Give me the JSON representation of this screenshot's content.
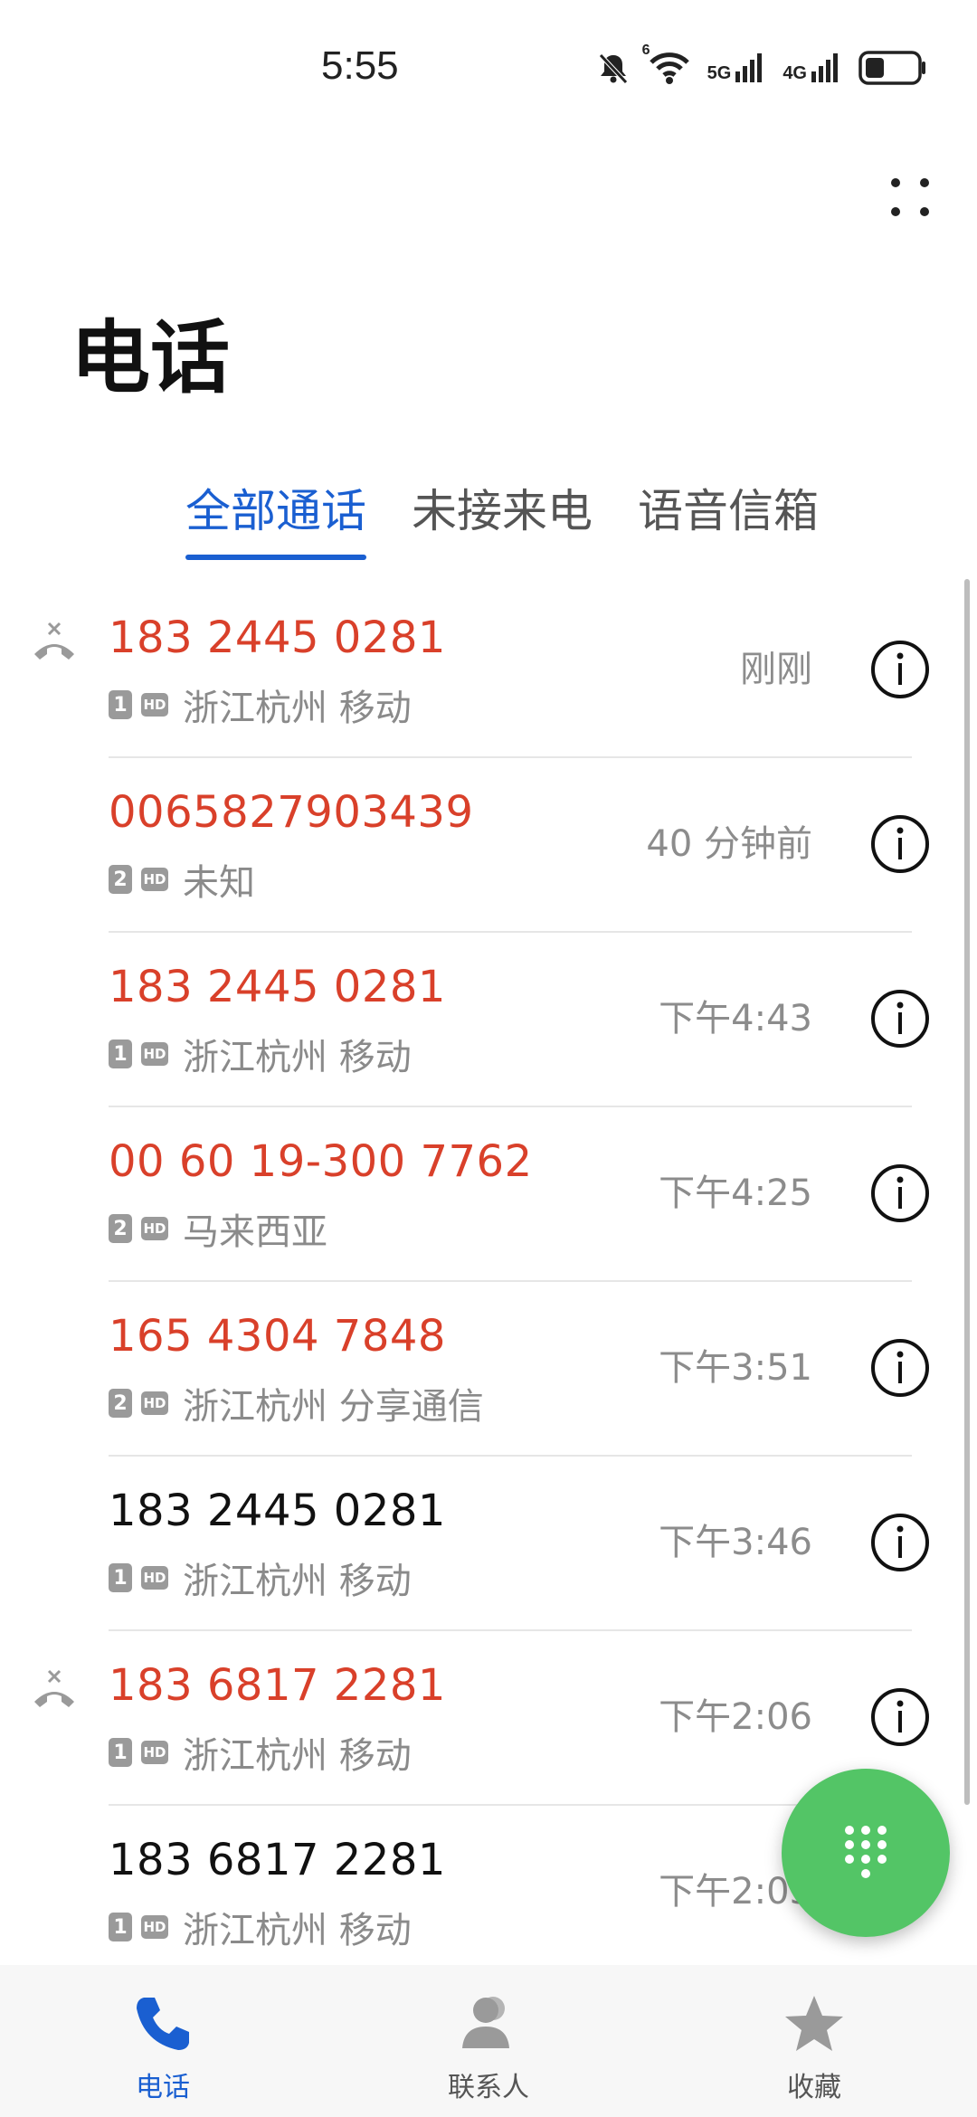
{
  "status_bar": {
    "time": "5:55",
    "net1": "5G",
    "net2": "4G",
    "wifi_badge": "6"
  },
  "title": "电话",
  "tabs": [
    {
      "label": "全部通话",
      "active": true
    },
    {
      "label": "未接来电",
      "active": false
    },
    {
      "label": "语音信箱",
      "active": false
    }
  ],
  "calls": [
    {
      "number": "183 2445 0281",
      "sim": "1",
      "hd": "HD",
      "location": "浙江杭州 移动",
      "time": "刚刚",
      "missed": true
    },
    {
      "number": "0065827903439",
      "sim": "2",
      "hd": "HD",
      "location": "未知",
      "time": "40 分钟前",
      "missed": true
    },
    {
      "number": "183 2445 0281",
      "sim": "1",
      "hd": "HD",
      "location": "浙江杭州 移动",
      "time": "下午4:43",
      "missed": true
    },
    {
      "number": "00 60 19-300 7762",
      "sim": "2",
      "hd": "HD",
      "location": "马来西亚",
      "time": "下午4:25",
      "missed": true
    },
    {
      "number": "165 4304 7848",
      "sim": "2",
      "hd": "HD",
      "location": "浙江杭州 分享通信",
      "time": "下午3:51",
      "missed": true
    },
    {
      "number": "183 2445 0281",
      "sim": "1",
      "hd": "HD",
      "location": "浙江杭州 移动",
      "time": "下午3:46",
      "missed": false
    },
    {
      "number": "183 6817 2281",
      "sim": "1",
      "hd": "HD",
      "location": "浙江杭州 移动",
      "time": "下午2:06",
      "missed": true
    },
    {
      "number": "183 6817 2281",
      "sim": "1",
      "hd": "HD",
      "location": "浙江杭州 移动",
      "time": "下午2:03",
      "missed": false
    }
  ],
  "bottom_nav": [
    {
      "label": "电话",
      "icon": "phone-icon",
      "active": true
    },
    {
      "label": "联系人",
      "icon": "contacts-icon",
      "active": false
    },
    {
      "label": "收藏",
      "icon": "star-icon",
      "active": false
    }
  ],
  "colors": {
    "accent": "#1a5fd1",
    "missed": "#d9402a",
    "fab": "#53c566"
  }
}
